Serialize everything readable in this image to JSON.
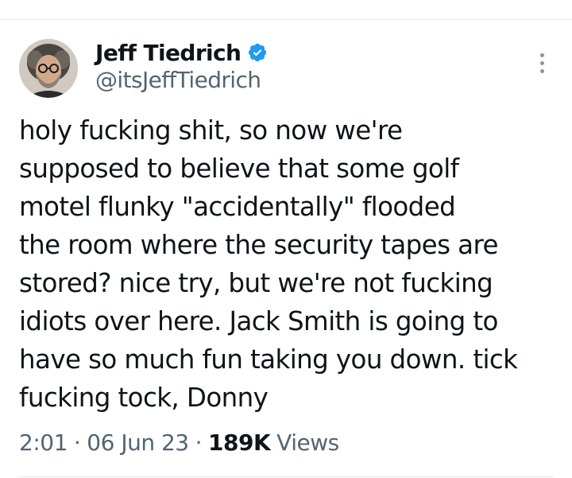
{
  "tweet": {
    "author": {
      "display_name": "Jeff Tiedrich",
      "handle": "@itsJeffTiedrich",
      "verified": true
    },
    "text_lines": [
      "holy fucking shit, so now we're",
      "supposed to believe that some golf",
      "motel flunky \"accidentally\" flooded",
      "the room where the security tapes are",
      "stored? nice try, but we're not fucking",
      "idiots over here. Jack Smith is going to",
      "have so much fun taking you down. tick",
      "fucking tock, Donny"
    ],
    "meta": {
      "time": "2:01",
      "separator": "·",
      "date": "06 Jun 23",
      "views_count": "189K",
      "views_label": "Views"
    }
  },
  "icons": {
    "verified": "verified-badge-icon",
    "more": "more-options-icon"
  },
  "colors": {
    "text_primary": "#0f1419",
    "text_secondary": "#536471",
    "verified_blue": "#1d9bf0",
    "divider": "#e6e6e6"
  }
}
